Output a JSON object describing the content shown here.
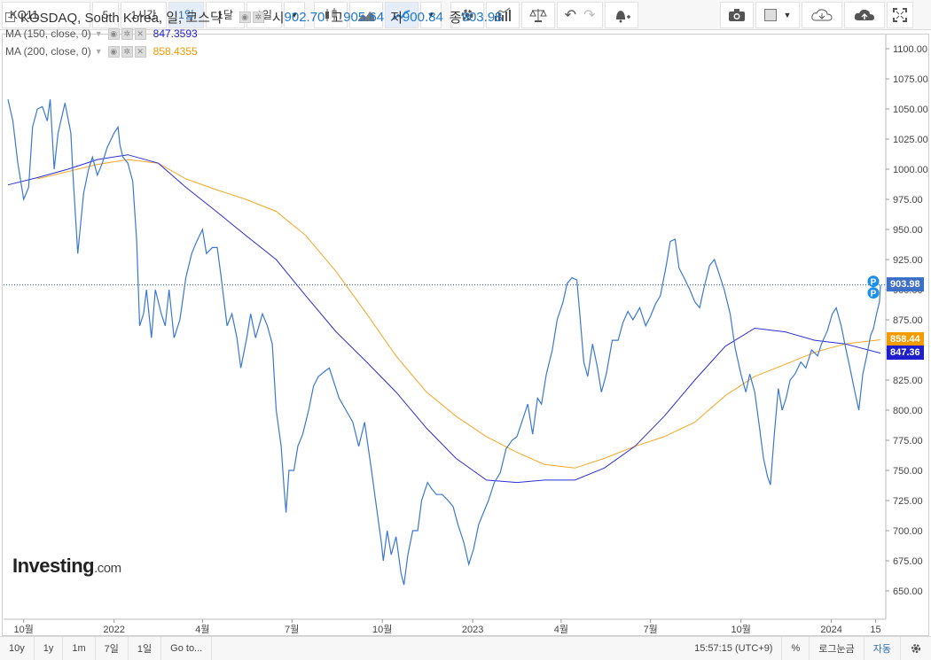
{
  "toolbar": {
    "symbol": "KQ11",
    "interval_items": [
      "5",
      "1시간",
      "1일",
      "1달",
      "1일"
    ],
    "active_interval": 2
  },
  "legend": {
    "title": "KOSDAQ, South Korea, 일, 코스닥",
    "open_label": "시",
    "open": "902.70",
    "high_label": "고",
    "high": "905.64",
    "low_label": "저",
    "low": "900.84",
    "close_label": "종",
    "close": "903.98",
    "ma150_label": "MA (150, close, 0)",
    "ma150_value": "847.3593",
    "ma200_label": "MA (200, close, 0)",
    "ma200_value": "858.4355"
  },
  "price_tags": {
    "last": "903.98",
    "ma200": "858.44",
    "ma150": "847.36",
    "marker": "P"
  },
  "watermark": {
    "brand": "Investing",
    "suffix": ".com"
  },
  "bottombar": {
    "ranges": [
      "10y",
      "1y",
      "1m",
      "7일",
      "1일"
    ],
    "goto": "Go to...",
    "time": "15:57:15 (UTC+9)",
    "percent": "%",
    "log": "로그눈금",
    "auto": "자동"
  },
  "colors": {
    "price": "#3b78d0",
    "ma150": "#2c2cd6",
    "ma200": "#f5a623",
    "last_line": "#1f4fa0",
    "last_tag": "#3d6fc6",
    "ma200_tag": "#f59b00",
    "ma150_tag": "#1e1ecc",
    "marker": "#1e90e8"
  },
  "chart_data": {
    "type": "line",
    "title": "KOSDAQ, South Korea, 일, 코스닥",
    "ylim": [
      625,
      1112
    ],
    "yticks": [
      650,
      675,
      700,
      725,
      750,
      775,
      800,
      825,
      850,
      875,
      900,
      925,
      950,
      975,
      1000,
      1025,
      1050,
      1075,
      1100
    ],
    "xlim": [
      "2021-09-15",
      "2024-02-20"
    ],
    "xticks": [
      {
        "label": "10월",
        "date": "2021-10-01"
      },
      {
        "label": "2022",
        "date": "2022-01-01"
      },
      {
        "label": "4월",
        "date": "2022-04-01"
      },
      {
        "label": "7월",
        "date": "2022-07-01"
      },
      {
        "label": "10월",
        "date": "2022-10-01"
      },
      {
        "label": "2023",
        "date": "2023-01-01"
      },
      {
        "label": "4월",
        "date": "2023-04-01"
      },
      {
        "label": "7월",
        "date": "2023-07-01"
      },
      {
        "label": "10월",
        "date": "2023-10-01"
      },
      {
        "label": "2024",
        "date": "2024-01-01"
      },
      {
        "label": "15",
        "date": "2024-02-15"
      }
    ],
    "grid": false,
    "legend": "top-left",
    "series": [
      {
        "name": "KOSDAQ",
        "points": [
          [
            "2021-09-15",
            1058
          ],
          [
            "2021-09-20",
            1040
          ],
          [
            "2021-09-25",
            1005
          ],
          [
            "2021-10-01",
            975
          ],
          [
            "2021-10-06",
            985
          ],
          [
            "2021-10-10",
            1035
          ],
          [
            "2021-10-15",
            1050
          ],
          [
            "2021-10-20",
            1052
          ],
          [
            "2021-10-25",
            1040
          ],
          [
            "2021-10-28",
            1058
          ],
          [
            "2021-11-01",
            1000
          ],
          [
            "2021-11-05",
            1030
          ],
          [
            "2021-11-12",
            1055
          ],
          [
            "2021-11-18",
            1030
          ],
          [
            "2021-11-20",
            998
          ],
          [
            "2021-11-25",
            930
          ],
          [
            "2021-12-01",
            980
          ],
          [
            "2021-12-06",
            1000
          ],
          [
            "2021-12-10",
            1010
          ],
          [
            "2021-12-15",
            995
          ],
          [
            "2021-12-20",
            1005
          ],
          [
            "2021-12-25",
            1018
          ],
          [
            "2022-01-01",
            1030
          ],
          [
            "2022-01-05",
            1035
          ],
          [
            "2022-01-07",
            1020
          ],
          [
            "2022-01-10",
            1010
          ],
          [
            "2022-01-15",
            1005
          ],
          [
            "2022-01-20",
            990
          ],
          [
            "2022-01-24",
            940
          ],
          [
            "2022-01-27",
            870
          ],
          [
            "2022-01-31",
            880
          ],
          [
            "2022-02-03",
            900
          ],
          [
            "2022-02-08",
            860
          ],
          [
            "2022-02-12",
            900
          ],
          [
            "2022-02-18",
            880
          ],
          [
            "2022-02-22",
            870
          ],
          [
            "2022-02-26",
            900
          ],
          [
            "2022-03-03",
            860
          ],
          [
            "2022-03-09",
            875
          ],
          [
            "2022-03-15",
            910
          ],
          [
            "2022-03-21",
            930
          ],
          [
            "2022-03-26",
            940
          ],
          [
            "2022-04-01",
            950
          ],
          [
            "2022-04-05",
            930
          ],
          [
            "2022-04-11",
            935
          ],
          [
            "2022-04-16",
            935
          ],
          [
            "2022-04-20",
            910
          ],
          [
            "2022-04-26",
            870
          ],
          [
            "2022-05-01",
            880
          ],
          [
            "2022-05-06",
            860
          ],
          [
            "2022-05-10",
            835
          ],
          [
            "2022-05-16",
            860
          ],
          [
            "2022-05-20",
            880
          ],
          [
            "2022-05-25",
            860
          ],
          [
            "2022-06-01",
            880
          ],
          [
            "2022-06-06",
            870
          ],
          [
            "2022-06-11",
            855
          ],
          [
            "2022-06-15",
            800
          ],
          [
            "2022-06-20",
            770
          ],
          [
            "2022-06-23",
            735
          ],
          [
            "2022-06-25",
            715
          ],
          [
            "2022-06-28",
            750
          ],
          [
            "2022-07-03",
            750
          ],
          [
            "2022-07-07",
            770
          ],
          [
            "2022-07-12",
            780
          ],
          [
            "2022-07-18",
            800
          ],
          [
            "2022-07-23",
            820
          ],
          [
            "2022-07-28",
            828
          ],
          [
            "2022-08-03",
            832
          ],
          [
            "2022-08-08",
            835
          ],
          [
            "2022-08-14",
            820
          ],
          [
            "2022-08-18",
            810
          ],
          [
            "2022-08-25",
            800
          ],
          [
            "2022-09-01",
            790
          ],
          [
            "2022-09-07",
            770
          ],
          [
            "2022-09-13",
            790
          ],
          [
            "2022-09-20",
            750
          ],
          [
            "2022-09-25",
            720
          ],
          [
            "2022-09-30",
            690
          ],
          [
            "2022-10-02",
            675
          ],
          [
            "2022-10-06",
            700
          ],
          [
            "2022-10-10",
            680
          ],
          [
            "2022-10-15",
            695
          ],
          [
            "2022-10-20",
            665
          ],
          [
            "2022-10-23",
            655
          ],
          [
            "2022-10-27",
            680
          ],
          [
            "2022-11-01",
            700
          ],
          [
            "2022-11-06",
            700
          ],
          [
            "2022-11-10",
            725
          ],
          [
            "2022-11-16",
            740
          ],
          [
            "2022-11-20",
            735
          ],
          [
            "2022-11-25",
            730
          ],
          [
            "2022-12-01",
            730
          ],
          [
            "2022-12-07",
            725
          ],
          [
            "2022-12-12",
            720
          ],
          [
            "2022-12-17",
            705
          ],
          [
            "2022-12-23",
            690
          ],
          [
            "2022-12-28",
            672
          ],
          [
            "2023-01-02",
            685
          ],
          [
            "2023-01-07",
            705
          ],
          [
            "2023-01-12",
            715
          ],
          [
            "2023-01-17",
            725
          ],
          [
            "2023-01-23",
            740
          ],
          [
            "2023-01-29",
            748
          ],
          [
            "2023-02-04",
            768
          ],
          [
            "2023-02-10",
            775
          ],
          [
            "2023-02-15",
            778
          ],
          [
            "2023-02-20",
            790
          ],
          [
            "2023-02-26",
            805
          ],
          [
            "2023-03-03",
            780
          ],
          [
            "2023-03-08",
            810
          ],
          [
            "2023-03-12",
            805
          ],
          [
            "2023-03-17",
            830
          ],
          [
            "2023-03-23",
            850
          ],
          [
            "2023-03-28",
            875
          ],
          [
            "2023-04-03",
            890
          ],
          [
            "2023-04-07",
            905
          ],
          [
            "2023-04-12",
            910
          ],
          [
            "2023-04-17",
            908
          ],
          [
            "2023-04-20",
            880
          ],
          [
            "2023-04-24",
            840
          ],
          [
            "2023-04-28",
            828
          ],
          [
            "2023-05-03",
            855
          ],
          [
            "2023-05-08",
            835
          ],
          [
            "2023-05-12",
            815
          ],
          [
            "2023-05-17",
            830
          ],
          [
            "2023-05-23",
            858
          ],
          [
            "2023-05-29",
            858
          ],
          [
            "2023-06-03",
            873
          ],
          [
            "2023-06-08",
            882
          ],
          [
            "2023-06-13",
            875
          ],
          [
            "2023-06-20",
            885
          ],
          [
            "2023-06-26",
            870
          ],
          [
            "2023-07-01",
            878
          ],
          [
            "2023-07-06",
            888
          ],
          [
            "2023-07-11",
            895
          ],
          [
            "2023-07-17",
            920
          ],
          [
            "2023-07-21",
            940
          ],
          [
            "2023-07-26",
            942
          ],
          [
            "2023-07-30",
            918
          ],
          [
            "2023-08-04",
            910
          ],
          [
            "2023-08-10",
            900
          ],
          [
            "2023-08-15",
            890
          ],
          [
            "2023-08-20",
            885
          ],
          [
            "2023-08-24",
            900
          ],
          [
            "2023-08-30",
            920
          ],
          [
            "2023-09-04",
            925
          ],
          [
            "2023-09-08",
            915
          ],
          [
            "2023-09-14",
            900
          ],
          [
            "2023-09-20",
            880
          ],
          [
            "2023-09-25",
            852
          ],
          [
            "2023-10-01",
            830
          ],
          [
            "2023-10-06",
            815
          ],
          [
            "2023-10-10",
            830
          ],
          [
            "2023-10-15",
            815
          ],
          [
            "2023-10-20",
            785
          ],
          [
            "2023-10-24",
            760
          ],
          [
            "2023-10-28",
            745
          ],
          [
            "2023-10-31",
            738
          ],
          [
            "2023-11-04",
            780
          ],
          [
            "2023-11-08",
            818
          ],
          [
            "2023-11-12",
            800
          ],
          [
            "2023-11-16",
            810
          ],
          [
            "2023-11-20",
            825
          ],
          [
            "2023-11-25",
            830
          ],
          [
            "2023-12-01",
            840
          ],
          [
            "2023-12-06",
            835
          ],
          [
            "2023-12-12",
            850
          ],
          [
            "2023-12-18",
            845
          ],
          [
            "2023-12-22",
            855
          ],
          [
            "2023-12-28",
            866
          ],
          [
            "2024-01-02",
            880
          ],
          [
            "2024-01-06",
            885
          ],
          [
            "2024-01-11",
            870
          ],
          [
            "2024-01-16",
            850
          ],
          [
            "2024-01-20",
            835
          ],
          [
            "2024-01-25",
            815
          ],
          [
            "2024-01-29",
            800
          ],
          [
            "2024-02-02",
            830
          ],
          [
            "2024-02-06",
            845
          ],
          [
            "2024-02-10",
            862
          ],
          [
            "2024-02-13",
            868
          ],
          [
            "2024-02-16",
            880
          ],
          [
            "2024-02-19",
            890
          ],
          [
            "2024-02-20",
            903.98
          ]
        ]
      },
      {
        "name": "MA (150, close, 0)",
        "points": [
          [
            "2021-09-15",
            987
          ],
          [
            "2021-10-15",
            993
          ],
          [
            "2021-11-15",
            1000
          ],
          [
            "2021-12-15",
            1008
          ],
          [
            "2022-01-15",
            1012
          ],
          [
            "2022-02-15",
            1005
          ],
          [
            "2022-03-15",
            985
          ],
          [
            "2022-04-15",
            965
          ],
          [
            "2022-05-15",
            945
          ],
          [
            "2022-06-15",
            925
          ],
          [
            "2022-07-15",
            895
          ],
          [
            "2022-08-15",
            865
          ],
          [
            "2022-09-15",
            840
          ],
          [
            "2022-10-15",
            815
          ],
          [
            "2022-11-15",
            785
          ],
          [
            "2022-12-15",
            760
          ],
          [
            "2023-01-15",
            742
          ],
          [
            "2023-02-15",
            740
          ],
          [
            "2023-03-15",
            742
          ],
          [
            "2023-04-15",
            742
          ],
          [
            "2023-05-15",
            752
          ],
          [
            "2023-06-15",
            770
          ],
          [
            "2023-07-15",
            795
          ],
          [
            "2023-08-15",
            825
          ],
          [
            "2023-09-15",
            853
          ],
          [
            "2023-10-15",
            868
          ],
          [
            "2023-11-15",
            865
          ],
          [
            "2023-12-15",
            858
          ],
          [
            "2024-01-15",
            855
          ],
          [
            "2024-02-20",
            847.36
          ]
        ]
      },
      {
        "name": "MA (200, close, 0)",
        "points": [
          [
            "2021-10-15",
            992
          ],
          [
            "2021-11-15",
            998
          ],
          [
            "2021-12-15",
            1004
          ],
          [
            "2022-01-15",
            1008
          ],
          [
            "2022-02-15",
            1005
          ],
          [
            "2022-03-15",
            992
          ],
          [
            "2022-04-15",
            983
          ],
          [
            "2022-05-15",
            975
          ],
          [
            "2022-06-15",
            965
          ],
          [
            "2022-07-15",
            945
          ],
          [
            "2022-08-15",
            915
          ],
          [
            "2022-09-15",
            880
          ],
          [
            "2022-10-15",
            845
          ],
          [
            "2022-11-15",
            815
          ],
          [
            "2022-12-15",
            795
          ],
          [
            "2023-01-15",
            778
          ],
          [
            "2023-02-15",
            765
          ],
          [
            "2023-03-15",
            755
          ],
          [
            "2023-04-15",
            752
          ],
          [
            "2023-05-15",
            760
          ],
          [
            "2023-06-15",
            770
          ],
          [
            "2023-07-15",
            778
          ],
          [
            "2023-08-15",
            790
          ],
          [
            "2023-09-15",
            812
          ],
          [
            "2023-10-15",
            828
          ],
          [
            "2023-11-15",
            838
          ],
          [
            "2023-12-15",
            848
          ],
          [
            "2024-01-15",
            855
          ],
          [
            "2024-02-20",
            858.44
          ]
        ]
      }
    ]
  }
}
